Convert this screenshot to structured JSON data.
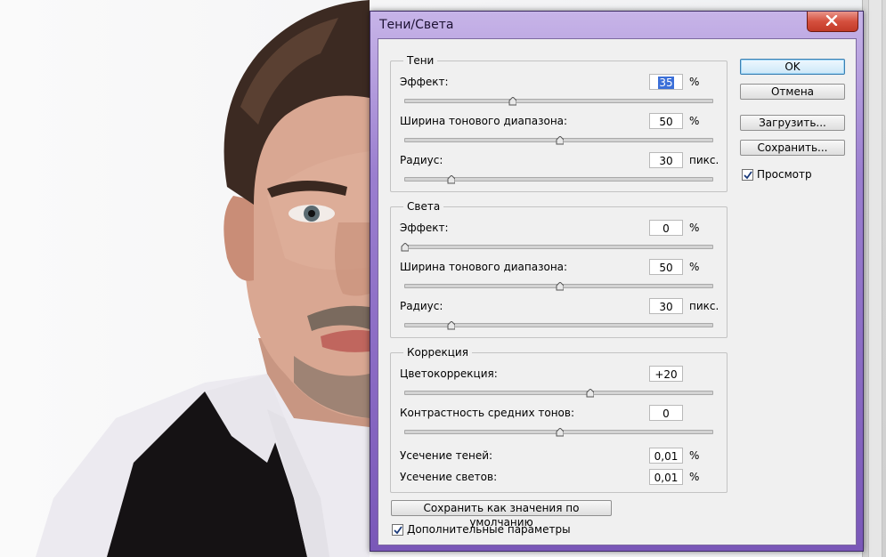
{
  "dialog": {
    "title": "Тени/Света",
    "ok_label": "OK",
    "cancel_label": "Отмена",
    "load_label": "Загрузить...",
    "save_label": "Сохранить...",
    "preview_label": "Просмотр",
    "preview_checked": true,
    "save_defaults_label": "Сохранить как значения по умолчанию",
    "more_options_label": "Дополнительные параметры",
    "more_options_checked": true
  },
  "shadows": {
    "title": "Тени",
    "amount": {
      "label": "Эффект:",
      "value": "35",
      "unit": "%",
      "slider_fraction": 0.35
    },
    "tonal_width": {
      "label": "Ширина тонового диапазона:",
      "value": "50",
      "unit": "%",
      "slider_fraction": 0.5
    },
    "radius": {
      "label": "Радиус:",
      "value": "30",
      "unit": "пикс.",
      "slider_fraction": 0.15
    }
  },
  "highlights": {
    "title": "Света",
    "amount": {
      "label": "Эффект:",
      "value": "0",
      "unit": "%",
      "slider_fraction": 0.0
    },
    "tonal_width": {
      "label": "Ширина тонового диапазона:",
      "value": "50",
      "unit": "%",
      "slider_fraction": 0.5
    },
    "radius": {
      "label": "Радиус:",
      "value": "30",
      "unit": "пикс.",
      "slider_fraction": 0.15
    }
  },
  "adjustments": {
    "title": "Коррекция",
    "color_correction": {
      "label": "Цветокоррекция:",
      "value": "+20",
      "slider_fraction": 0.6
    },
    "midtone_contrast": {
      "label": "Контрастность средних тонов:",
      "value": "0",
      "slider_fraction": 0.5
    },
    "black_clip": {
      "label": "Усечение теней:",
      "value": "0,01",
      "unit": "%"
    },
    "white_clip": {
      "label": "Усечение светов:",
      "value": "0,01",
      "unit": "%"
    }
  },
  "colors": {
    "selection": "#3b6fd8",
    "window_frame": "#7a58b8",
    "close_button": "#d5503e"
  }
}
